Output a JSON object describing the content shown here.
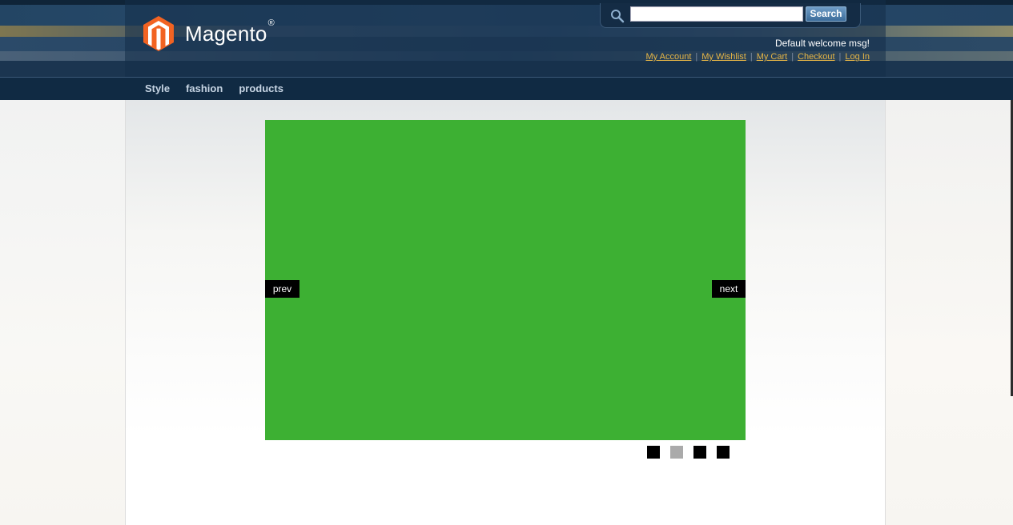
{
  "header": {
    "brand": "Magento",
    "brand_mark": "®",
    "welcome": "Default welcome msg!",
    "links": [
      "My Account",
      "My Wishlist",
      "My Cart",
      "Checkout",
      "Log In"
    ]
  },
  "search": {
    "value": "",
    "placeholder": "",
    "button_label": "Search"
  },
  "nav": {
    "items": [
      "Style",
      "fashion",
      "products"
    ]
  },
  "slider": {
    "prev_label": "prev",
    "next_label": "next",
    "slide_color": "#3db033",
    "pager_count": 4,
    "active_index": 1
  },
  "colors": {
    "accent_link": "#e5b546",
    "logo_orange": "#f26322",
    "pager_active": "#aaaaaa",
    "pager_inactive": "#000000"
  }
}
